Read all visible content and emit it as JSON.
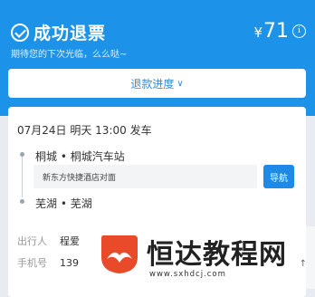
{
  "header": {
    "title": "成功退票",
    "subtitle": "期待您的下次光临，么么哒~",
    "refund_currency": "¥",
    "refund_value": "71",
    "info_icon_glyph": "i"
  },
  "progress": {
    "label": "退款进度",
    "chevron": "∨"
  },
  "trip": {
    "datetime": "07月24日 明天 13:00 发车",
    "departure": "桐城 • 桐城汽车站",
    "pickup_point": "新东方快捷酒店对面",
    "navigate_label": "导航",
    "arrival": "芜湖 • 芜湖"
  },
  "passenger": {
    "name_label": "出行人",
    "name_value": "程爱",
    "phone_label": "手机号",
    "phone_value": "139"
  },
  "watermark": {
    "text": "恒达教程网",
    "url": "www.sxhdcj.com",
    "corner_glyph": "↑"
  },
  "colors": {
    "header_bg": "#1c93e8",
    "accent": "#2d8de0",
    "watermark_logo": "#e84a2a"
  }
}
